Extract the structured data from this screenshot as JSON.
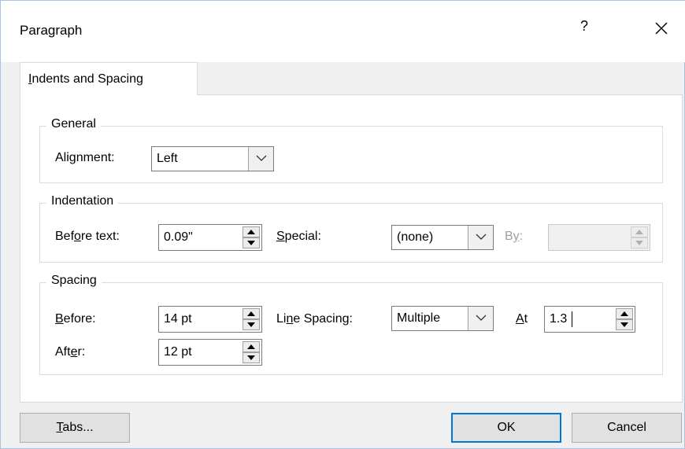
{
  "dialog": {
    "title": "Paragraph",
    "help_label": "?",
    "close_icon": "close-icon"
  },
  "tab": {
    "label_pre": "",
    "label_ul": "I",
    "label_post": "ndents and Spacing"
  },
  "general": {
    "group_label": "General",
    "alignment_label_pre": "Ali",
    "alignment_label_ul": "g",
    "alignment_label_post": "nment:",
    "alignment_value": "Left"
  },
  "indentation": {
    "group_label": "Indentation",
    "before_text_label_pre": "Bef",
    "before_text_label_ul": "o",
    "before_text_label_post": "re text:",
    "before_text_value": "0.09\"",
    "special_label_pre": "",
    "special_label_ul": "S",
    "special_label_post": "pecial:",
    "special_value": "(none)",
    "by_label_pre": "B",
    "by_label_ul": "y",
    "by_label_post": ":",
    "by_value": ""
  },
  "spacing": {
    "group_label": "Spacing",
    "before_label_pre": "",
    "before_label_ul": "B",
    "before_label_post": "efore:",
    "before_value": "14 pt",
    "after_label_pre": "Aft",
    "after_label_ul": "e",
    "after_label_post": "r:",
    "after_value": "12 pt",
    "line_spacing_label_pre": "Li",
    "line_spacing_label_ul": "n",
    "line_spacing_label_post": "e Spacing:",
    "line_spacing_value": "Multiple",
    "at_label_pre": "",
    "at_label_ul": "A",
    "at_label_post": "t",
    "at_value": "1.3"
  },
  "footer": {
    "tabs_pre": "",
    "tabs_ul": "T",
    "tabs_post": "abs...",
    "ok_label": "OK",
    "cancel_label": "Cancel"
  }
}
